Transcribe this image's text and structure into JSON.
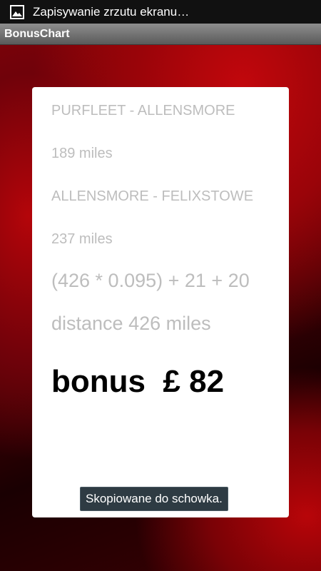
{
  "status_bar": {
    "notification_icon": "image-icon",
    "notification_text": "Zapisywanie zrzutu ekranu…"
  },
  "app": {
    "title": "BonusChart"
  },
  "card": {
    "route_1": "PURFLEET - ALLENSMORE",
    "route_1_distance": "189 miles",
    "route_2": "ALLENSMORE - FELIXSTOWE",
    "route_2_distance": "237 miles",
    "formula": "(426 * 0.095) + 21 + 20",
    "total_distance": "distance 426 miles",
    "bonus": "bonus  £ 82"
  },
  "toast": {
    "message": "Skopiowane do schowka."
  },
  "colors": {
    "accent": "#c2070c",
    "muted_text": "#bdbdbd",
    "toast_bg": "#2e3b43"
  }
}
